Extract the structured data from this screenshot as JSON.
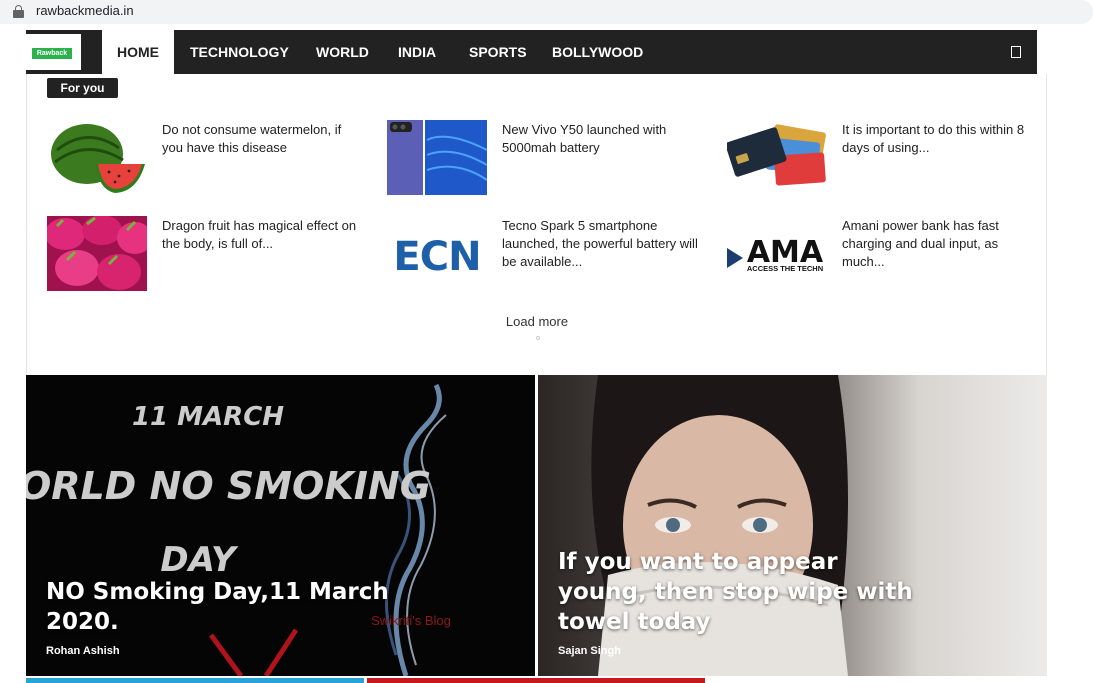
{
  "browser": {
    "url": "rawbackmedia.in"
  },
  "logo": {
    "text": "Rawback"
  },
  "nav": {
    "items": [
      {
        "label": "HOME",
        "active": true
      },
      {
        "label": "TECHNOLOGY"
      },
      {
        "label": "WORLD"
      },
      {
        "label": "INDIA"
      },
      {
        "label": "SPORTS"
      },
      {
        "label": "BOLLYWOOD"
      }
    ]
  },
  "foryou": {
    "label": "For you",
    "cards": [
      {
        "title": "Do not consume watermelon, if you have this disease",
        "thumb": "watermelon"
      },
      {
        "title": "New Vivo Y50 launched with 5000mah battery",
        "thumb": "phone"
      },
      {
        "title": "It is important to do this within 8 days of using...",
        "thumb": "credit-cards"
      },
      {
        "title": "Dragon fruit has magical effect on the body, is full of...",
        "thumb": "dragon-fruit"
      },
      {
        "title": "Tecno Spark 5 smartphone launched, the powerful battery will be available...",
        "thumb": "ecn-logo"
      },
      {
        "title": "Amani power bank has fast charging and dual input, as much...",
        "thumb": "ama-logo"
      }
    ],
    "load_more": "Load more"
  },
  "thumb_text": {
    "ecn": "ECN",
    "ama": "AMA",
    "ama_sub": "ACCESS THE TECHN"
  },
  "hero": [
    {
      "image_text": {
        "date": "11 MARCH",
        "line1": "WORLD NO SMOKING",
        "line2": "DAY",
        "watermark": "Swikriti's Blog"
      },
      "title": "NO Smoking Day,11 March 2020.",
      "author": "Rohan Ashish"
    },
    {
      "title": "If you want to appear young, then stop wipe with towel today",
      "author": "Sajan Singh"
    }
  ],
  "colors": {
    "nav_bg": "#222222",
    "strip_blue": "#29a3d6",
    "strip_red": "#c8171e"
  }
}
